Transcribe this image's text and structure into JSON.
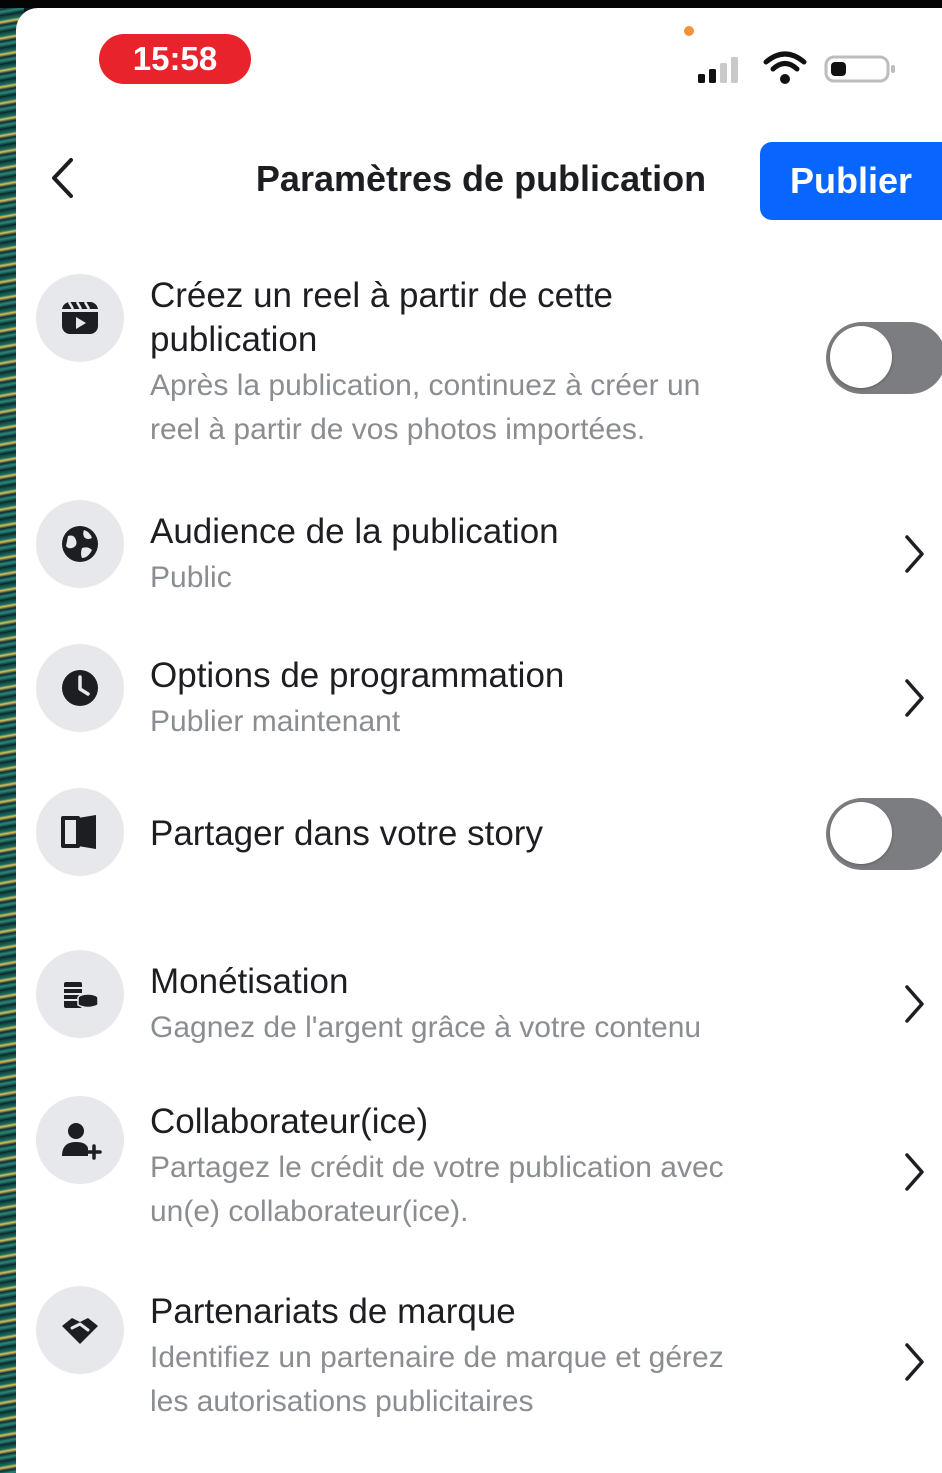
{
  "status_bar": {
    "time": "15:58"
  },
  "header": {
    "title": "Paramètres de publication",
    "publish_label": "Publier"
  },
  "rows": [
    {
      "icon": "reel-icon",
      "title_line1": "Créez un reel à partir de cette",
      "title_line2": "publication",
      "sub_line1": "Après la publication, continuez à créer un",
      "sub_line2": "reel à partir de vos photos importées.",
      "control": "toggle",
      "toggle_on": false
    },
    {
      "icon": "globe-icon",
      "title": "Audience de la publication",
      "subtitle": "Public",
      "control": "chevron"
    },
    {
      "icon": "clock-icon",
      "title": "Options de programmation",
      "subtitle": "Publier maintenant",
      "control": "chevron"
    },
    {
      "icon": "story-icon",
      "title": "Partager dans votre story",
      "control": "toggle",
      "toggle_on": false
    },
    {
      "icon": "coins-icon",
      "title": "Monétisation",
      "subtitle": "Gagnez de l'argent grâce à votre contenu",
      "control": "chevron"
    },
    {
      "icon": "add-person-icon",
      "title": "Collaborateur(ice)",
      "sub_line1": "Partagez le crédit de votre publication avec",
      "sub_line2": "un(e) collaborateur(ice).",
      "control": "chevron"
    },
    {
      "icon": "handshake-icon",
      "title": "Partenariats de marque",
      "sub_line1": "Identifiez un partenaire de marque et gérez",
      "sub_line2": "les autorisations publicitaires",
      "control": "chevron"
    }
  ],
  "colors": {
    "accent": "#0866ff",
    "time_pill": "#e8232c",
    "toggle_off": "#7b7d80",
    "icon_bg": "#e7e8eb"
  }
}
